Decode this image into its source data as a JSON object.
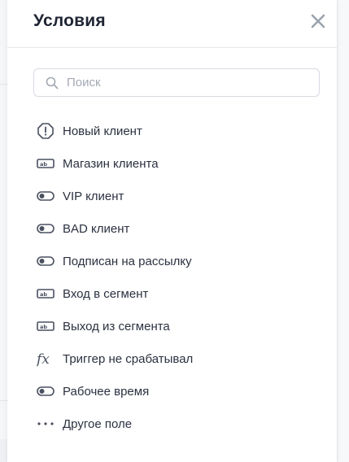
{
  "panel": {
    "title": "Условия",
    "close_icon": "close-icon"
  },
  "search": {
    "placeholder": "Поиск",
    "value": ""
  },
  "conditions": [
    {
      "label": "Новый клиент",
      "icon": "octagon-alert-icon"
    },
    {
      "label": "Магазин клиента",
      "icon": "text-field-icon"
    },
    {
      "label": "VIP клиент",
      "icon": "toggle-icon"
    },
    {
      "label": "BAD клиент",
      "icon": "toggle-icon"
    },
    {
      "label": "Подписан на рассылку",
      "icon": "toggle-icon"
    },
    {
      "label": "Вход в сегмент",
      "icon": "text-field-icon"
    },
    {
      "label": "Выход из сегмента",
      "icon": "text-field-icon"
    },
    {
      "label": "Триггер не срабатывал",
      "icon": "function-icon"
    },
    {
      "label": "Рабочее время",
      "icon": "toggle-icon"
    },
    {
      "label": "Другое поле",
      "icon": "more-dots-icon"
    }
  ],
  "colors": {
    "text": "#2b3140",
    "icon": "#4a5060",
    "border": "#d6dae1",
    "close": "#9aa3ad"
  }
}
